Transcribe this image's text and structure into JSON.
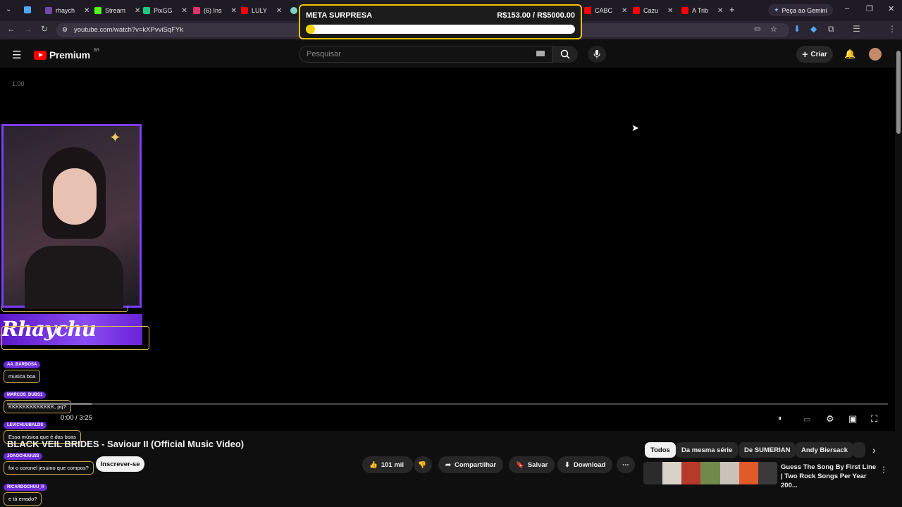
{
  "browser": {
    "tabs": [
      {
        "label": "rhaych",
        "color": "#6f4aa8"
      },
      {
        "label": "Stream",
        "color": "#53fc18"
      },
      {
        "label": "PixGG",
        "color": "#1ec883"
      },
      {
        "label": "(6) Ins",
        "color": "#e1306c"
      },
      {
        "label": "LULY",
        "color": "#ff0000"
      },
      {
        "label": "CABC",
        "color": "#ff0000"
      },
      {
        "label": "Cazu",
        "color": "#ff0000"
      },
      {
        "label": "A Trib",
        "color": "#ff0000"
      }
    ],
    "new_tab": "+",
    "gemini_label": "Peça ao Gemini",
    "url": "youtube.com/watch?v=kXPvviSqFYk"
  },
  "overlay": {
    "goal_title": "META SURPRESA",
    "goal_value": "R$153.00 / R$5000.00",
    "goal_fraction": 0.0306,
    "streamer_name": "Rhaychu",
    "speed": "1.00"
  },
  "chat": [
    {
      "user": "AA_BARBOSA",
      "message": "musica boa"
    },
    {
      "user": "MARCOS_DUBS1",
      "message": "KKKKKKKKKKKKK, pq?"
    },
    {
      "user": "LEVICHUUBALDS",
      "message": "Essa música que é das boas"
    },
    {
      "user": "JOAOCHUUU33",
      "message": "foi o coronel jesuino que compos?"
    },
    {
      "user": "RICARDOCHUU_II",
      "message": "e tá errado?"
    }
  ],
  "youtube": {
    "logo_text": "Premium",
    "region": "BR",
    "search_placeholder": "Pesquisar",
    "create_label": "Criar",
    "time": "0:00 / 3:25",
    "video_title": "BLACK VEIL BRIDES - Saviour II (Official Music Video)",
    "subscribe_label": "Inscrever-se",
    "like_count": "101 mil",
    "share_label": "Compartilhar",
    "save_label": "Salvar",
    "download_label": "Download",
    "chips": [
      "Todos",
      "Da mesma série",
      "De SUMERIAN",
      "Andy Biersack"
    ],
    "recommendation_title": "Guess The Song By First Line | Two Rock Songs Per Year 200..."
  }
}
